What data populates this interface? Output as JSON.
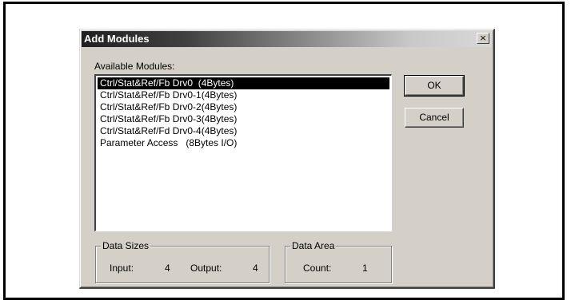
{
  "window": {
    "title": "Add Modules",
    "close_glyph": "×"
  },
  "available_modules": {
    "label": "Available Modules:",
    "selected_index": 0,
    "items": [
      "Ctrl/Stat&Ref/Fb Drv0  (4Bytes)",
      "Ctrl/Stat&Ref/Fb Drv0-1(4Bytes)",
      "Ctrl/Stat&Ref/Fb Drv0-2(4Bytes)",
      "Ctrl/Stat&Ref/Fb Drv0-3(4Bytes)",
      "Ctrl/Stat&Ref/Fd Drv0-4(4Bytes)",
      "Parameter Access   (8Bytes I/O)"
    ]
  },
  "buttons": {
    "ok_label": "OK",
    "cancel_label": "Cancel"
  },
  "data_sizes": {
    "title": "Data Sizes",
    "input_label": "Input:",
    "input_value": "4",
    "output_label": "Output:",
    "output_value": "4"
  },
  "data_area": {
    "title": "Data Area",
    "count_label": "Count:",
    "count_value": "1"
  }
}
